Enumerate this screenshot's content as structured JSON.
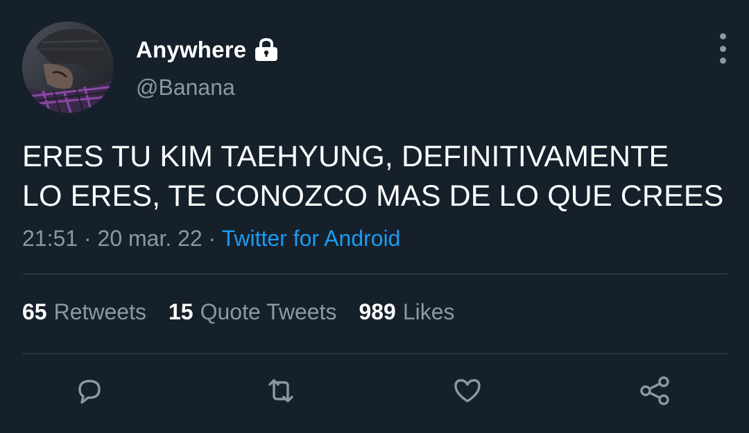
{
  "user": {
    "display_name": "Anywhere",
    "handle": "@Banana",
    "protected_icon": "lock-icon",
    "avatar_icon": "avatar-photo"
  },
  "tweet": {
    "text_lines": [
      "ERES TU KIM TAEHYUNG, DEFINITIVAMENTE",
      "LO ERES, TE CONOZCO MAS DE LO QUE CREES"
    ],
    "time": "21:51",
    "separator": "·",
    "date": "20 mar. 22",
    "source": "Twitter for Android"
  },
  "stats": {
    "retweets": {
      "count": "65",
      "label": "Retweets"
    },
    "quotes": {
      "count": "15",
      "label": "Quote Tweets"
    },
    "likes": {
      "count": "989",
      "label": "Likes"
    }
  },
  "actions": [
    "reply-icon",
    "retweet-icon",
    "like-icon",
    "share-icon"
  ],
  "colors": {
    "background": "#15202b",
    "text": "#ffffff",
    "secondary": "#8b98a5",
    "link": "#1d9bf0",
    "divider": "#38444d"
  }
}
